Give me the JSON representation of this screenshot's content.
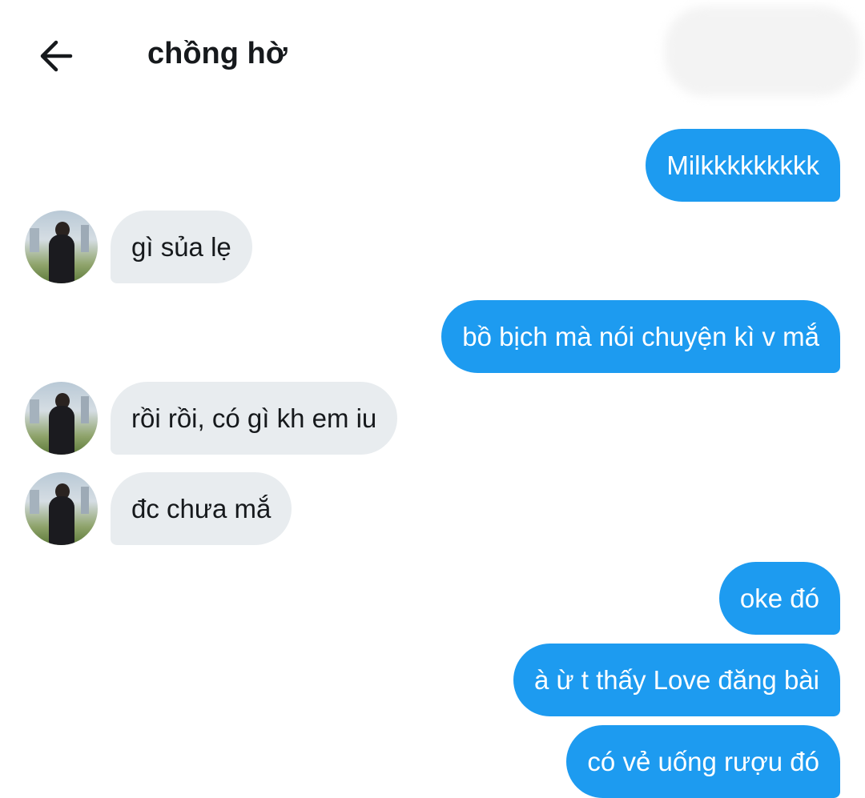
{
  "header": {
    "back_icon": "arrow-left-icon",
    "title": "chồng hờ"
  },
  "colors": {
    "outgoing_bubble": "#1d9bf0",
    "incoming_bubble": "#e8ecef",
    "outgoing_text": "#ffffff",
    "incoming_text": "#16191c"
  },
  "messages": [
    {
      "direction": "out",
      "text": "Milkkkkkkkkk"
    },
    {
      "direction": "in",
      "text": "gì sủa lẹ"
    },
    {
      "direction": "out",
      "text": "bồ bịch mà nói chuyện kì v mắ"
    },
    {
      "direction": "in",
      "text": "rồi rồi, có gì kh em iu"
    },
    {
      "direction": "in",
      "text": "đc chưa mắ"
    },
    {
      "direction": "out",
      "text": "oke đó"
    },
    {
      "direction": "out",
      "text": "à ừ t thấy Love đăng bài"
    },
    {
      "direction": "out",
      "text": "có vẻ uống rượu đó"
    }
  ]
}
